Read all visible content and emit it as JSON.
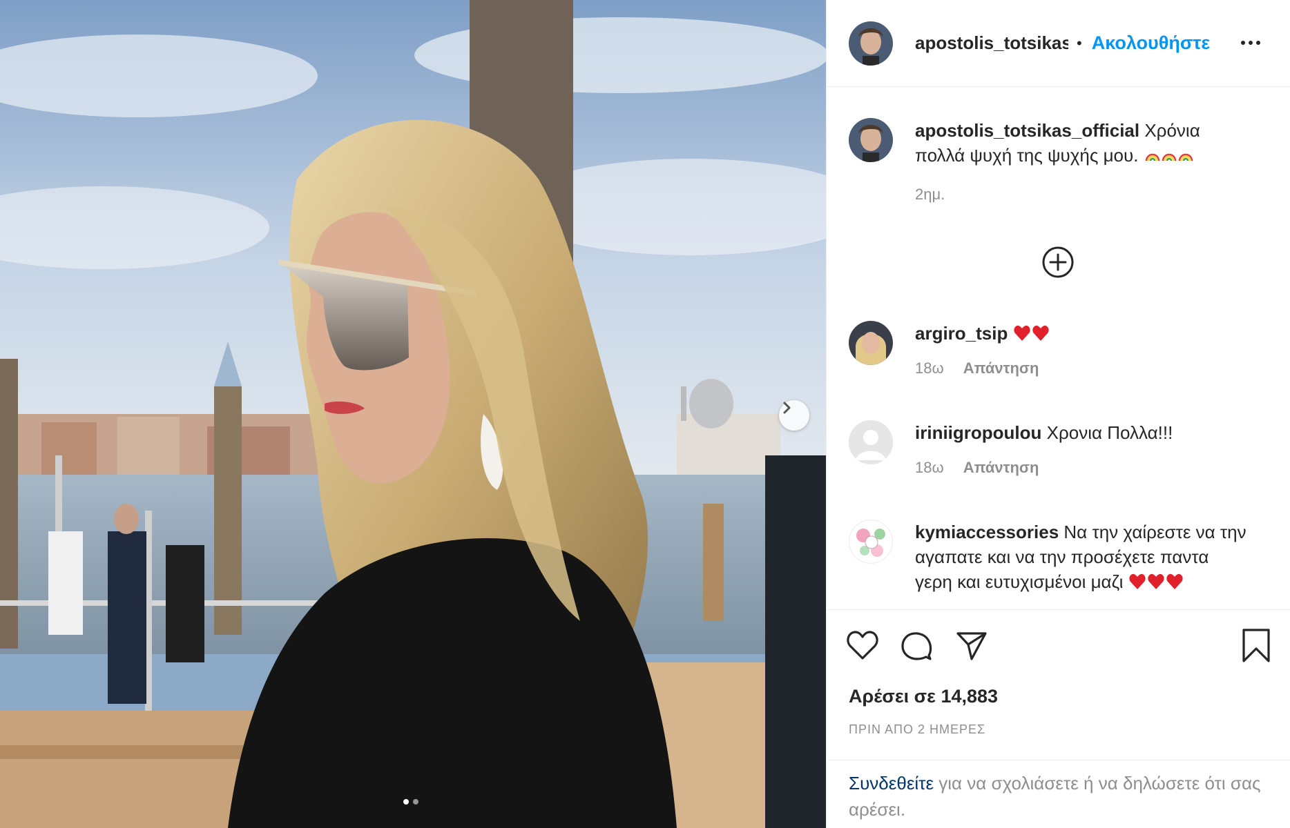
{
  "header": {
    "username": "apostolis_totsikas_official",
    "separator": "•",
    "follow_label": "Ακολουθήστε",
    "more_icon": "more-dots-icon"
  },
  "caption": {
    "username": "apostolis_totsikas_official",
    "text": "Χρόνια πολλά ψυχή της ψυχής μου.",
    "emoji": "rainbow-emoji x3",
    "time": "2ημ."
  },
  "load_more_icon": "plus-circle-icon",
  "comments": [
    {
      "username": "argiro_tsip",
      "text": "",
      "emoji": "red-heart-emoji x2",
      "time": "18ω",
      "reply_label": "Απάντηση"
    },
    {
      "username": "iriniigropoulou",
      "text": "Χρονια Πολλα!!!",
      "time": "18ω",
      "reply_label": "Απάντηση"
    },
    {
      "username": "kymiaccessories",
      "text": "Να την χαίρεστε να την αγαπατε και να την προσέχετε παντα γερη και ευτυχισμένοι μαζι",
      "emoji": "red-heart-emoji x3"
    }
  ],
  "actions": {
    "like_icon": "heart-icon",
    "comment_icon": "comment-icon",
    "share_icon": "paper-plane-icon",
    "save_icon": "bookmark-icon"
  },
  "likes_text": "Αρέσει σε 14,883",
  "timestamp_text": "ΠΡΙΝ ΑΠΟ 2 ΗΜΕΡΕΣ",
  "login_note": {
    "link_label": "Συνδεθείτε",
    "rest": " για να σχολιάσετε ή να δηλώσετε ότι σας αρέσει."
  },
  "carousel": {
    "current": 1,
    "total": 2,
    "next_icon": "chevron-right-icon"
  },
  "colors": {
    "accent_blue": "#0095f6",
    "text": "#262626",
    "muted": "#8e8e8e",
    "heart_red": "#ed4956"
  }
}
